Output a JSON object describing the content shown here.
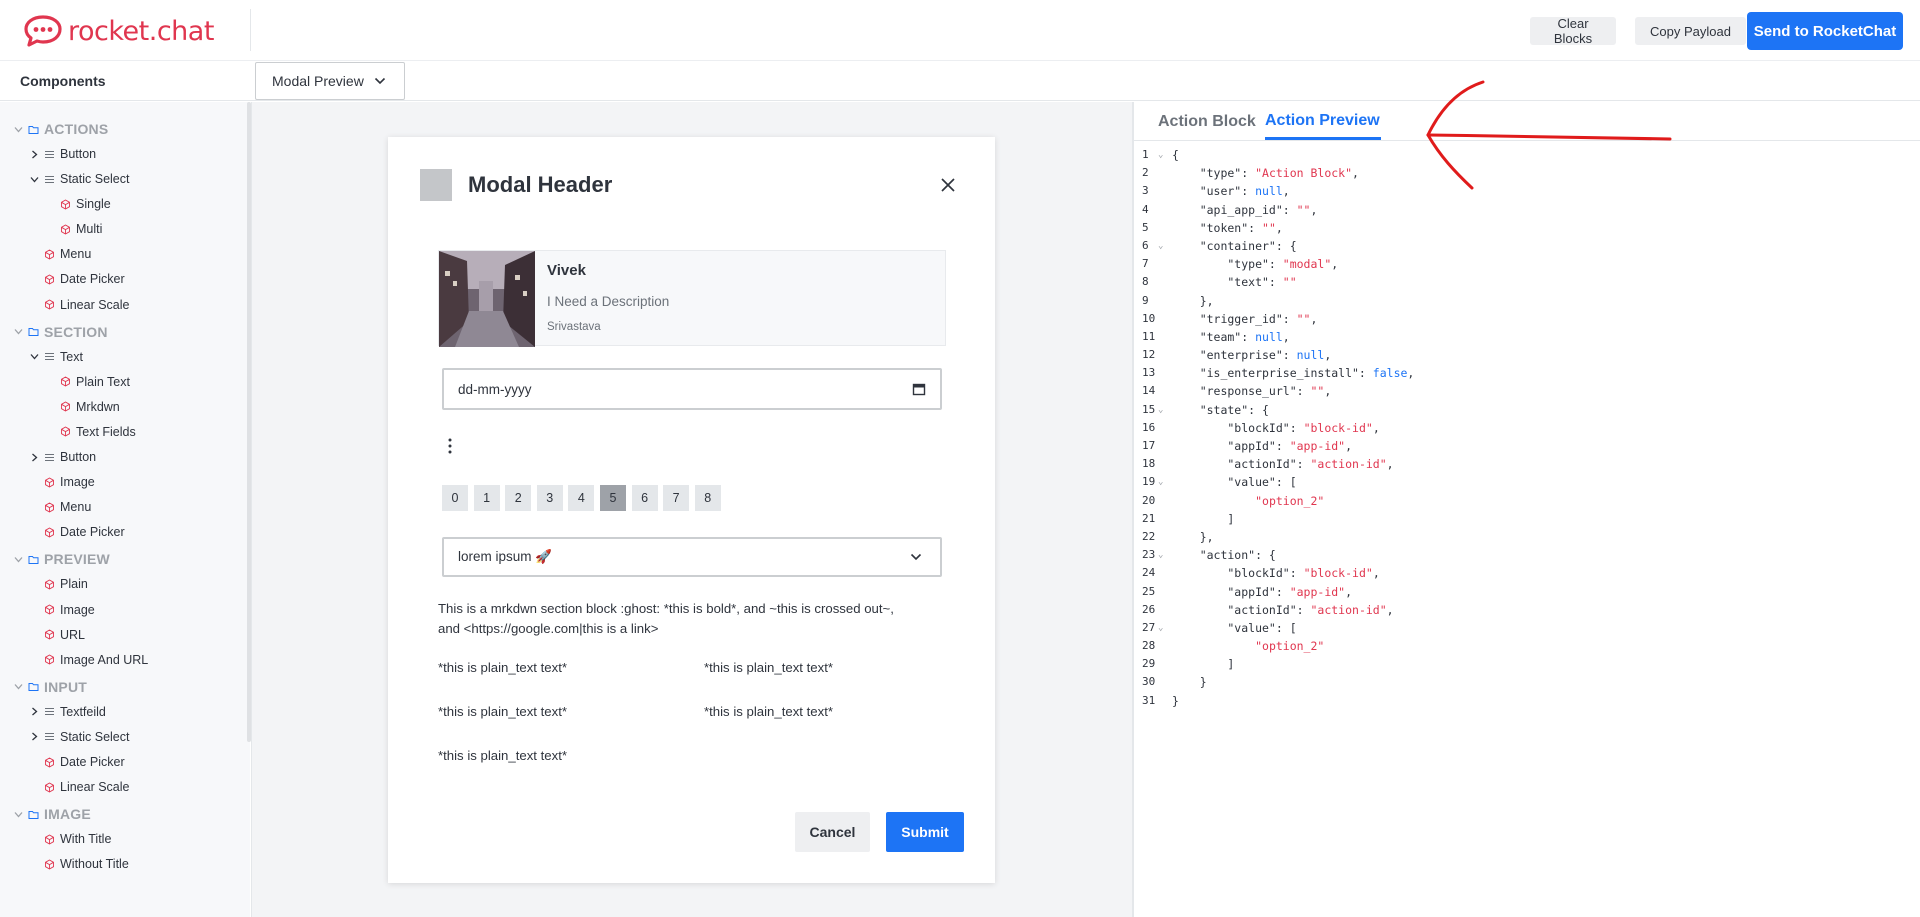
{
  "header": {
    "logo_text": "rocket.chat",
    "brand_color": "#e0364f",
    "clear_label": "Clear Blocks",
    "copy_label": "Copy Payload",
    "send_label": "Send to RocketChat"
  },
  "subbar": {
    "components_title": "Components",
    "surface_select": "Modal Preview"
  },
  "sidebar": {
    "items": [
      {
        "level": 0,
        "icon": "folder-icon",
        "label": "ACTIONS",
        "expanded": true
      },
      {
        "level": 1,
        "icon": "list-icon",
        "label": "Button",
        "expanded": false
      },
      {
        "level": 1,
        "icon": "list-icon",
        "label": "Static Select",
        "expanded": true
      },
      {
        "level": 2,
        "icon": "block-icon",
        "label": "Single"
      },
      {
        "level": 2,
        "icon": "block-icon",
        "label": "Multi"
      },
      {
        "level": 1,
        "icon": "block-icon",
        "label": "Menu"
      },
      {
        "level": 1,
        "icon": "block-icon",
        "label": "Date Picker"
      },
      {
        "level": 1,
        "icon": "block-icon",
        "label": "Linear Scale"
      },
      {
        "level": 0,
        "icon": "folder-icon",
        "label": "SECTION",
        "expanded": true
      },
      {
        "level": 1,
        "icon": "list-icon",
        "label": "Text",
        "expanded": true
      },
      {
        "level": 2,
        "icon": "block-icon",
        "label": "Plain Text"
      },
      {
        "level": 2,
        "icon": "block-icon",
        "label": "Mrkdwn"
      },
      {
        "level": 2,
        "icon": "block-icon",
        "label": "Text Fields"
      },
      {
        "level": 1,
        "icon": "list-icon",
        "label": "Button",
        "expanded": false
      },
      {
        "level": 1,
        "icon": "block-icon",
        "label": "Image"
      },
      {
        "level": 1,
        "icon": "block-icon",
        "label": "Menu"
      },
      {
        "level": 1,
        "icon": "block-icon",
        "label": "Date Picker"
      },
      {
        "level": 0,
        "icon": "folder-icon",
        "label": "PREVIEW",
        "expanded": true
      },
      {
        "level": 1,
        "icon": "block-icon",
        "label": "Plain"
      },
      {
        "level": 1,
        "icon": "block-icon",
        "label": "Image"
      },
      {
        "level": 1,
        "icon": "block-icon",
        "label": "URL"
      },
      {
        "level": 1,
        "icon": "block-icon",
        "label": "Image And URL"
      },
      {
        "level": 0,
        "icon": "folder-icon",
        "label": "INPUT",
        "expanded": true
      },
      {
        "level": 1,
        "icon": "list-icon",
        "label": "Textfeild",
        "expanded": false
      },
      {
        "level": 1,
        "icon": "list-icon",
        "label": "Static Select",
        "expanded": false
      },
      {
        "level": 1,
        "icon": "block-icon",
        "label": "Date Picker"
      },
      {
        "level": 1,
        "icon": "block-icon",
        "label": "Linear Scale"
      },
      {
        "level": 0,
        "icon": "folder-icon",
        "label": "IMAGE",
        "expanded": true
      },
      {
        "level": 1,
        "icon": "block-icon",
        "label": "With Title"
      },
      {
        "level": 1,
        "icon": "block-icon",
        "label": "Without Title"
      }
    ]
  },
  "modal": {
    "title": "Modal Header",
    "context": {
      "name": "Vivek",
      "description": "I Need a Description",
      "subtext": "Srivastava"
    },
    "date_placeholder": "dd-mm-yyyy",
    "linear_scale": [
      "0",
      "1",
      "2",
      "3",
      "4",
      "5",
      "6",
      "7",
      "8"
    ],
    "linear_scale_selected": "5",
    "select_value": "lorem ipsum 🚀",
    "mrkdwn_line1": "This is a mrkdwn section block :ghost: *this is bold*, and ~this is crossed out~,",
    "mrkdwn_line2": "and <https://google.com|this is a link>",
    "fields": [
      "*this is plain_text text*",
      "*this is plain_text text*",
      "*this is plain_text text*",
      "*this is plain_text text*",
      "*this is plain_text text*"
    ],
    "cancel_label": "Cancel",
    "submit_label": "Submit"
  },
  "code_panel": {
    "tab_block": "Action Block",
    "tab_preview": "Action Preview",
    "active_tab": "Action Preview",
    "lines": [
      "{",
      "    \"type\": \"Action Block\",",
      "    \"user\": null,",
      "    \"api_app_id\": \"\",",
      "    \"token\": \"\",",
      "    \"container\": {",
      "        \"type\": \"modal\",",
      "        \"text\": \"\"",
      "    },",
      "    \"trigger_id\": \"\",",
      "    \"team\": null,",
      "    \"enterprise\": null,",
      "    \"is_enterprise_install\": false,",
      "    \"response_url\": \"\",",
      "    \"state\": {",
      "        \"blockId\": \"block-id\",",
      "        \"appId\": \"app-id\",",
      "        \"actionId\": \"action-id\",",
      "        \"value\": [",
      "            \"option_2\"",
      "        ]",
      "    },",
      "    \"action\": {",
      "        \"blockId\": \"block-id\",",
      "        \"appId\": \"app-id\",",
      "        \"actionId\": \"action-id\",",
      "        \"value\": [",
      "            \"option_2\"",
      "        ]",
      "    }",
      "}"
    ],
    "fold_lines": [
      1,
      6,
      15,
      19,
      23,
      27
    ]
  },
  "colors": {
    "primary": "#1d74f5",
    "brand": "#e0364f",
    "annotation": "#e01b1b"
  }
}
